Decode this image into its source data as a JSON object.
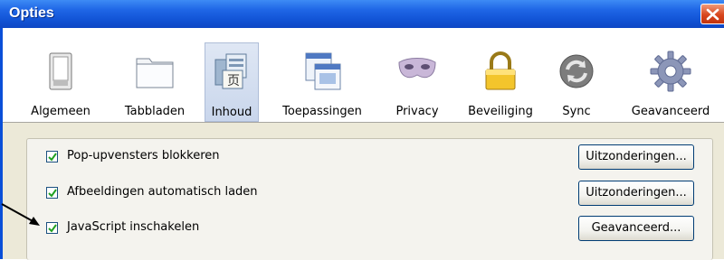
{
  "window": {
    "title": "Opties",
    "close_label": "×"
  },
  "toolbar": {
    "items": [
      {
        "label": "Algemeen",
        "icon": "switch-icon"
      },
      {
        "label": "Tabbladen",
        "icon": "folder-tabs-icon"
      },
      {
        "label": "Inhoud",
        "icon": "content-page-icon",
        "selected": true
      },
      {
        "label": "Toepassingen",
        "icon": "applications-icon"
      },
      {
        "label": "Privacy",
        "icon": "mask-icon"
      },
      {
        "label": "Beveiliging",
        "icon": "padlock-icon"
      },
      {
        "label": "Sync",
        "icon": "sync-icon"
      },
      {
        "label": "Geavanceerd",
        "icon": "gear-icon"
      }
    ]
  },
  "content": {
    "rows": [
      {
        "label": "Pop-upvensters blokkeren",
        "mnemonic": "P",
        "checked": true,
        "button": "Uitzonderingen..."
      },
      {
        "label": "Afbeeldingen automatisch laden",
        "mnemonic": "A",
        "checked": true,
        "button": "Uitzonderingen..."
      },
      {
        "label": "JavaScript inschakelen",
        "mnemonic": "J",
        "checked": true,
        "button": "Geavanceerd..."
      }
    ]
  },
  "colors": {
    "titlebar": "#1254d6",
    "dialog_bg": "#ece9d8",
    "checkmark": "#21a121",
    "close_button": "#d8461e"
  }
}
